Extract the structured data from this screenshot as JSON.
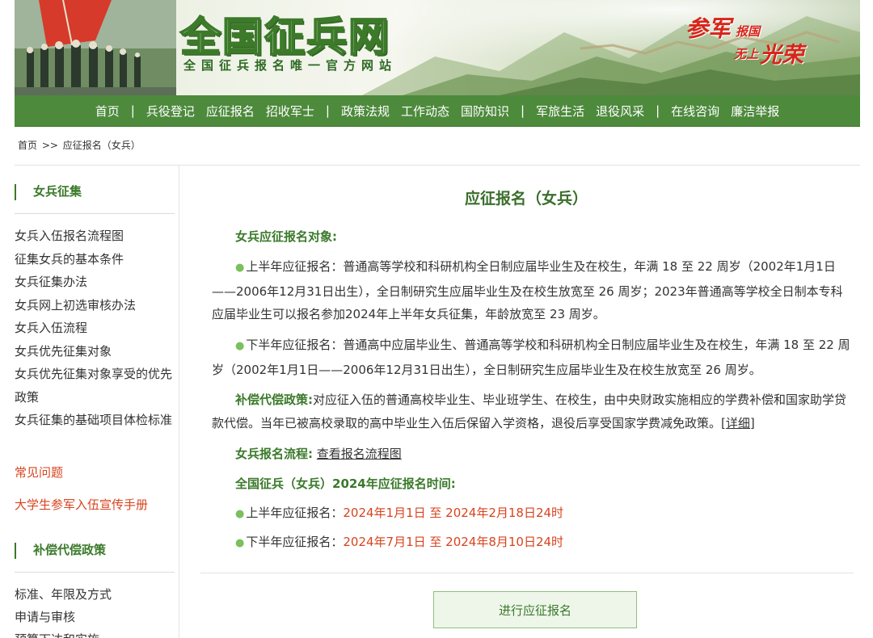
{
  "banner": {
    "logo_text": "全国征兵网",
    "logo_subtitle": "全国征兵报名唯一官方网站",
    "slogan": {
      "a": "参军",
      "b": "报国",
      "c": "无上",
      "d": "光荣"
    },
    "colors": {
      "nav_green": "#4d8a3c",
      "accent_red": "#d8241a"
    }
  },
  "nav": {
    "items": [
      {
        "label": "首页"
      },
      {
        "label": "兵役登记"
      },
      {
        "label": "应征报名"
      },
      {
        "label": "招收军士"
      },
      {
        "label": "政策法规"
      },
      {
        "label": "工作动态"
      },
      {
        "label": "国防知识"
      },
      {
        "label": "军旅生活"
      },
      {
        "label": "退役风采"
      },
      {
        "label": "在线咨询"
      },
      {
        "label": "廉洁举报"
      }
    ],
    "separator": "|"
  },
  "breadcrumb": {
    "home": "首页",
    "sep": ">>",
    "current": "应征报名（女兵）"
  },
  "sidebar": {
    "section1_title": "女兵征集",
    "section1_items": [
      "女兵入伍报名流程图",
      "征集女兵的基本条件",
      "女兵征集办法",
      "女兵网上初选审核办法",
      "女兵入伍流程",
      "女兵优先征集对象",
      "女兵优先征集对象享受的优先政策",
      "女兵征集的基础项目体检标准"
    ],
    "faq": "常见问题",
    "handbook": "大学生参军入伍宣传手册",
    "section2_title": "补偿代偿政策",
    "section2_items": [
      "标准、年限及方式",
      "申请与审核",
      "预算下达和实施"
    ]
  },
  "main": {
    "title": "应征报名（女兵）",
    "target_label": "女兵应征报名对象:",
    "first_half_text": "上半年应征报名：普通高等学校和科研机构全日制应届毕业生及在校生，年满 18 至 22 周岁（2002年1月1日——2006年12月31日出生），全日制研究生应届毕业生及在校生放宽至 26 周岁；2023年普通高等学校全日制本专科应届毕业生可以报名参加2024年上半年女兵征集，年龄放宽至 23 周岁。",
    "second_half_text": "下半年应征报名：普通高中应届毕业生、普通高等学校和科研机构全日制应届毕业生及在校生，年满 18 至 22 周岁（2002年1月1日——2006年12月31日出生），全日制研究生应届毕业生及在校生放宽至 26 周岁。",
    "compensation_label": "补偿代偿政策:",
    "compensation_text": "对应征入伍的普通高校毕业生、毕业班学生、在校生，由中央财政实施相应的学费补偿和国家助学贷款代偿。当年已被高校录取的高中毕业生入伍后保留入学资格，退役后享受国家学费减免政策。",
    "compensation_link": "[详细]",
    "process_label": "女兵报名流程:",
    "process_link": "查看报名流程图",
    "time_label": "全国征兵（女兵）2024年应征报名时间:",
    "time1_prefix": "上半年应征报名：",
    "time1_value": "2024年1月1日 至 2024年2月18日24时",
    "time2_prefix": "下半年应征报名：",
    "time2_value": "2024年7月1日 至 2024年8月10日24时",
    "apply_button": "进行应征报名",
    "bullet": "●"
  }
}
